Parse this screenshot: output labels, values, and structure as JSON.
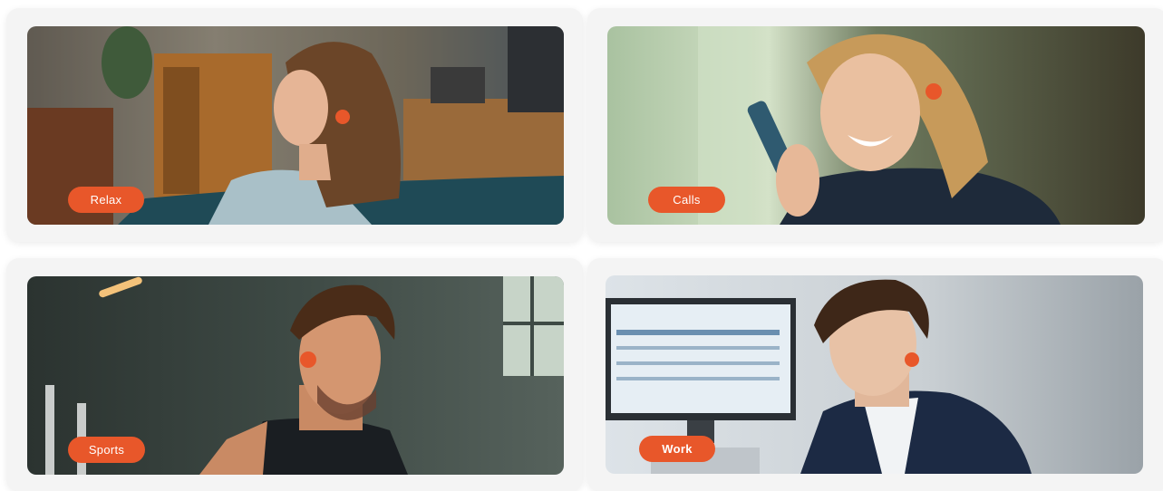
{
  "cards": [
    {
      "label": "Relax"
    },
    {
      "label": "Calls"
    },
    {
      "label": "Sports"
    },
    {
      "label": "Work"
    }
  ],
  "colors": {
    "accent": "#e8572a",
    "card_background": "#f4f4f4"
  }
}
